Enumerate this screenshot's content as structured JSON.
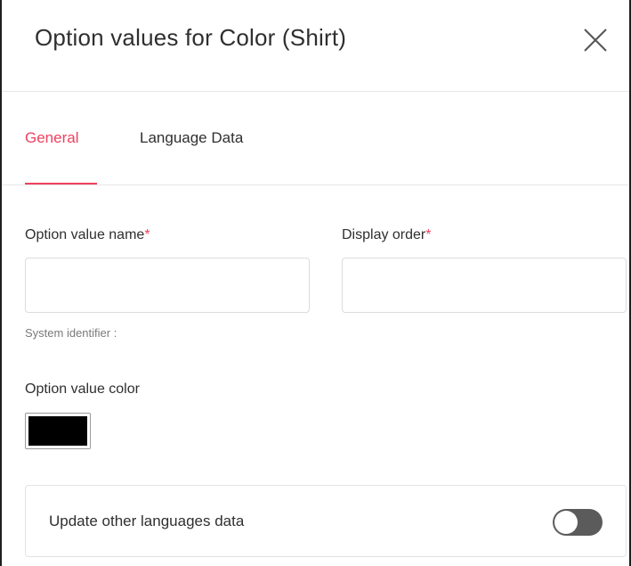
{
  "modal": {
    "title": "Option values for Color (Shirt)",
    "close_icon": "close-icon"
  },
  "tabs": [
    {
      "label": "General",
      "active": true
    },
    {
      "label": "Language Data",
      "active": false
    }
  ],
  "form": {
    "option_value_name": {
      "label": "Option value name",
      "required_mark": "*",
      "value": "",
      "placeholder": ""
    },
    "display_order": {
      "label": "Display order",
      "required_mark": "*",
      "value": "",
      "placeholder": ""
    },
    "system_identifier": "System identifier :",
    "option_value_color": {
      "label": "Option value color",
      "value": "#000000"
    },
    "update_languages": {
      "label": "Update other languages data",
      "enabled": false
    }
  },
  "colors": {
    "accent": "#f0415e",
    "toggle_off": "#5b5b5b",
    "swatch": "#000000"
  }
}
